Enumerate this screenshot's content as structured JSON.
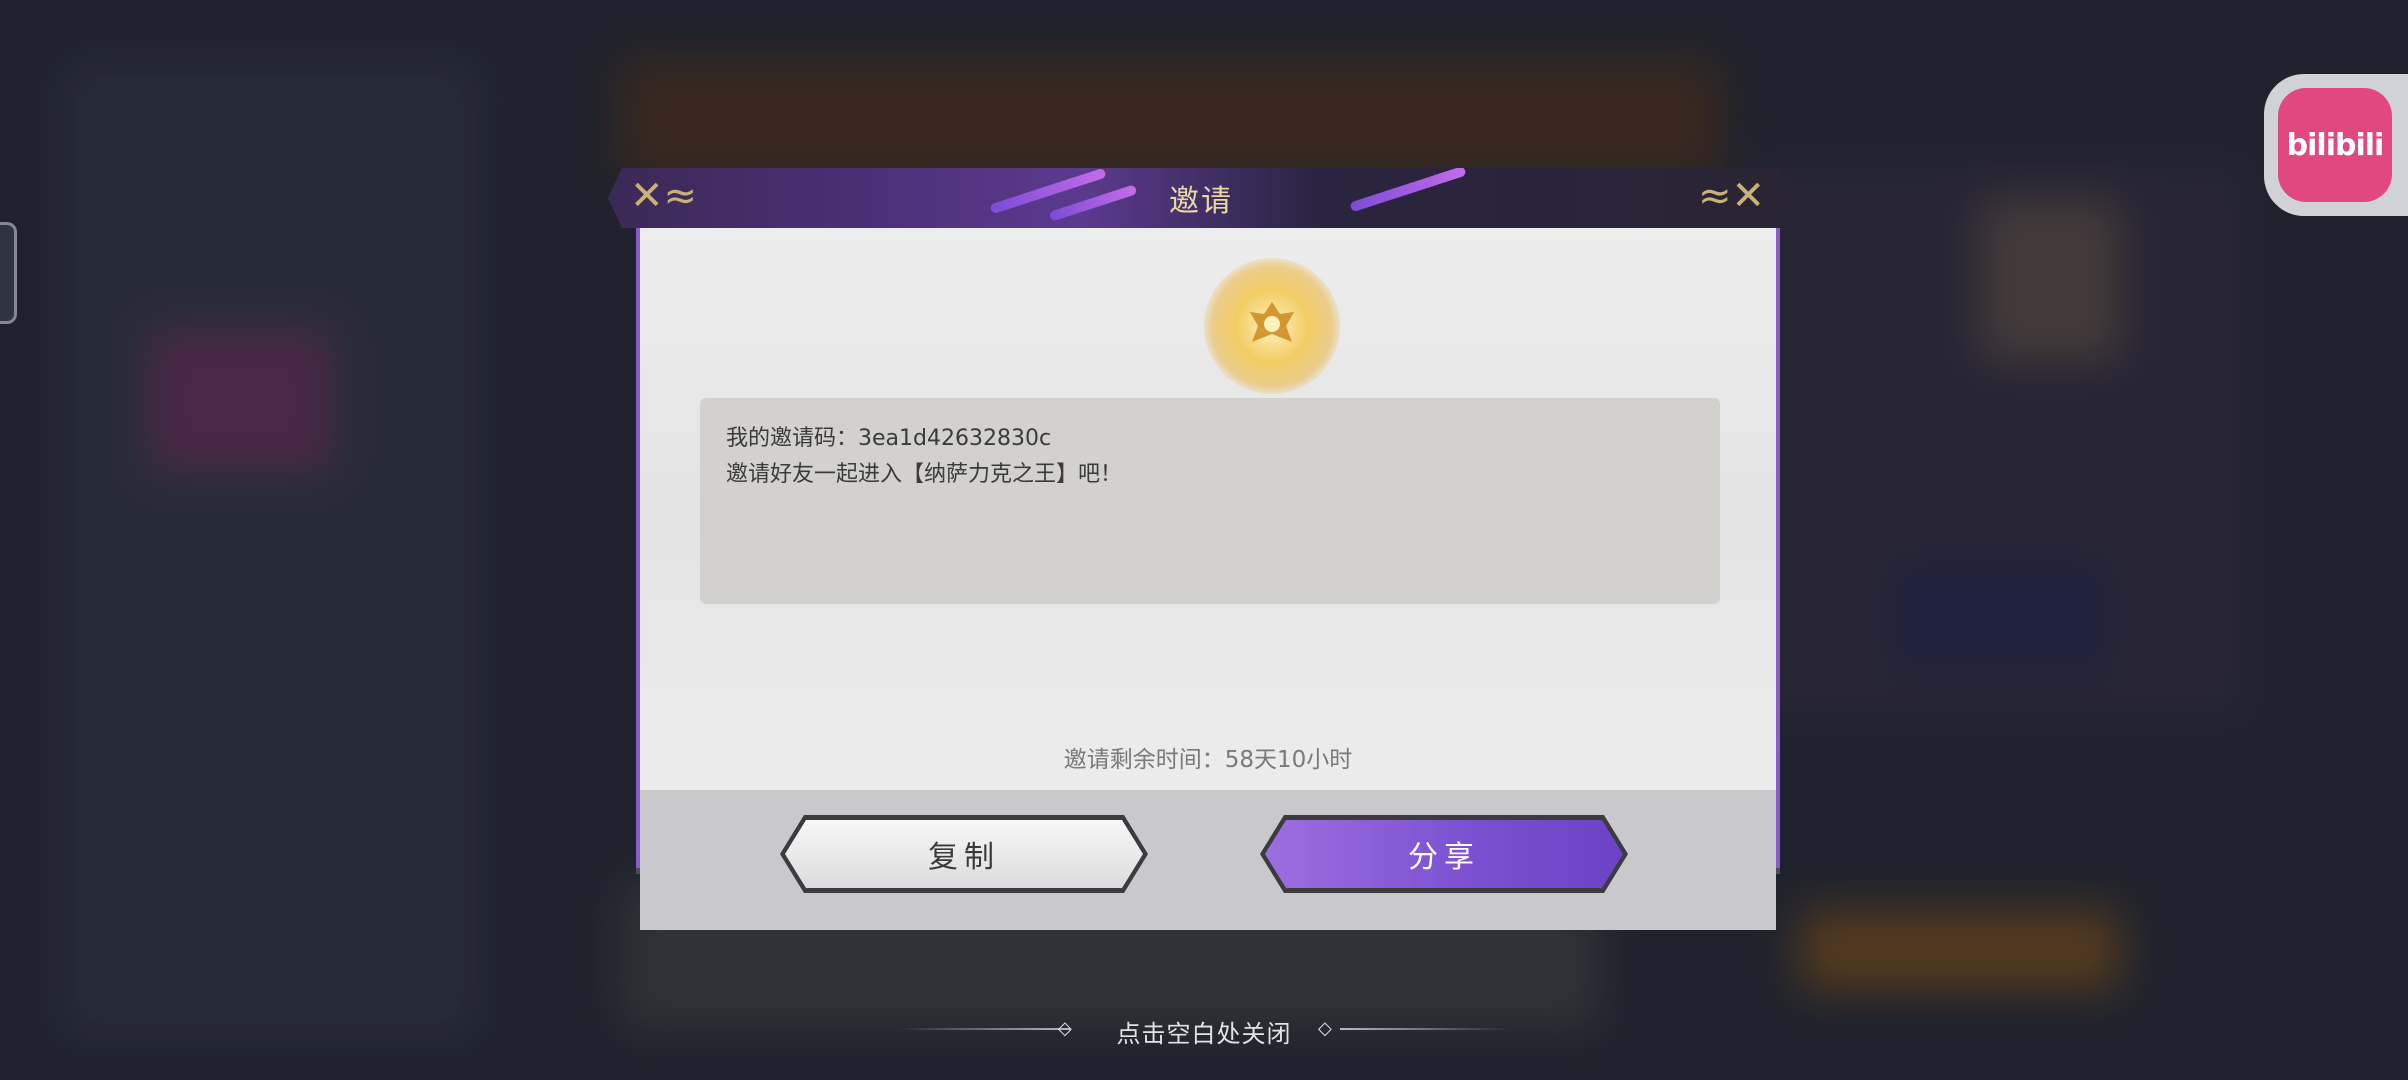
{
  "dialog": {
    "title": "邀请",
    "invite_code_line": "我的邀请码：3ea1d42632830c",
    "invite_message": "邀请好友一起进入【纳萨力克之王】吧！",
    "expire_text": "邀请剩余时间：58天10小时",
    "copy_label": "复制",
    "share_label": "分享",
    "emblem_icon": "golden-crest-icon"
  },
  "overlay": {
    "close_hint": "点击空白处关闭"
  },
  "floating": {
    "bilibili_label": "bilibili",
    "bilibili_color": "#e1487f"
  },
  "colors": {
    "accent_purple": "#7a4fd0",
    "title_gold": "#e9d7a4"
  }
}
